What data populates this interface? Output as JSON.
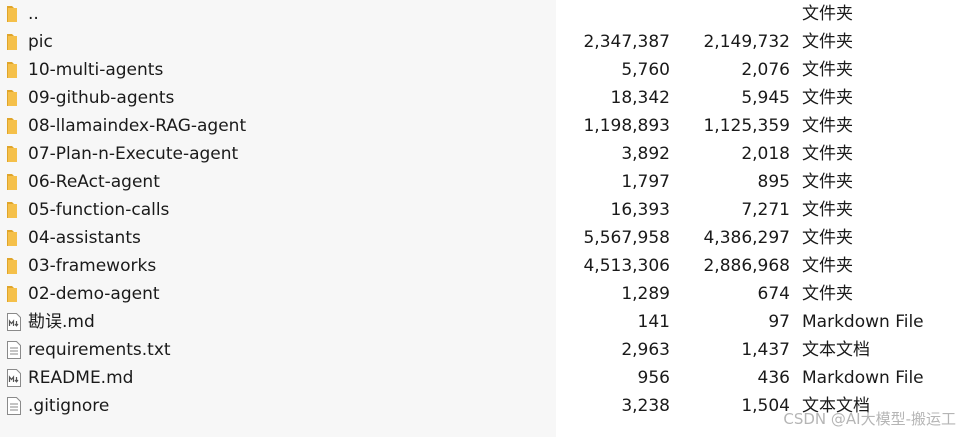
{
  "colors": {
    "folder": "#f5c04a",
    "folder_dark": "#e0a52a",
    "file_border": "#8a8a8a",
    "name_column_bg": "#f7f7f7",
    "watermark": "#787878"
  },
  "files": [
    {
      "name": "..",
      "size": "",
      "packed": "",
      "type": "文件夹",
      "icon": "folder-icon"
    },
    {
      "name": "pic",
      "size": "2,347,387",
      "packed": "2,149,732",
      "type": "文件夹",
      "icon": "folder-icon"
    },
    {
      "name": "10-multi-agents",
      "size": "5,760",
      "packed": "2,076",
      "type": "文件夹",
      "icon": "folder-icon"
    },
    {
      "name": "09-github-agents",
      "size": "18,342",
      "packed": "5,945",
      "type": "文件夹",
      "icon": "folder-icon"
    },
    {
      "name": "08-llamaindex-RAG-agent",
      "size": "1,198,893",
      "packed": "1,125,359",
      "type": "文件夹",
      "icon": "folder-icon"
    },
    {
      "name": "07-Plan-n-Execute-agent",
      "size": "3,892",
      "packed": "2,018",
      "type": "文件夹",
      "icon": "folder-icon"
    },
    {
      "name": "06-ReAct-agent",
      "size": "1,797",
      "packed": "895",
      "type": "文件夹",
      "icon": "folder-icon"
    },
    {
      "name": "05-function-calls",
      "size": "16,393",
      "packed": "7,271",
      "type": "文件夹",
      "icon": "folder-icon"
    },
    {
      "name": "04-assistants",
      "size": "5,567,958",
      "packed": "4,386,297",
      "type": "文件夹",
      "icon": "folder-icon"
    },
    {
      "name": "03-frameworks",
      "size": "4,513,306",
      "packed": "2,886,968",
      "type": "文件夹",
      "icon": "folder-icon"
    },
    {
      "name": "02-demo-agent",
      "size": "1,289",
      "packed": "674",
      "type": "文件夹",
      "icon": "folder-icon"
    },
    {
      "name": "勘误.md",
      "size": "141",
      "packed": "97",
      "type": "Markdown File",
      "icon": "markdown-file-icon"
    },
    {
      "name": "requirements.txt",
      "size": "2,963",
      "packed": "1,437",
      "type": "文本文档",
      "icon": "text-file-icon"
    },
    {
      "name": "README.md",
      "size": "956",
      "packed": "436",
      "type": "Markdown File",
      "icon": "markdown-file-icon"
    },
    {
      "name": ".gitignore",
      "size": "3,238",
      "packed": "1,504",
      "type": "文本文档",
      "icon": "text-file-icon"
    }
  ],
  "watermark": "CSDN @AI大模型-搬运工"
}
